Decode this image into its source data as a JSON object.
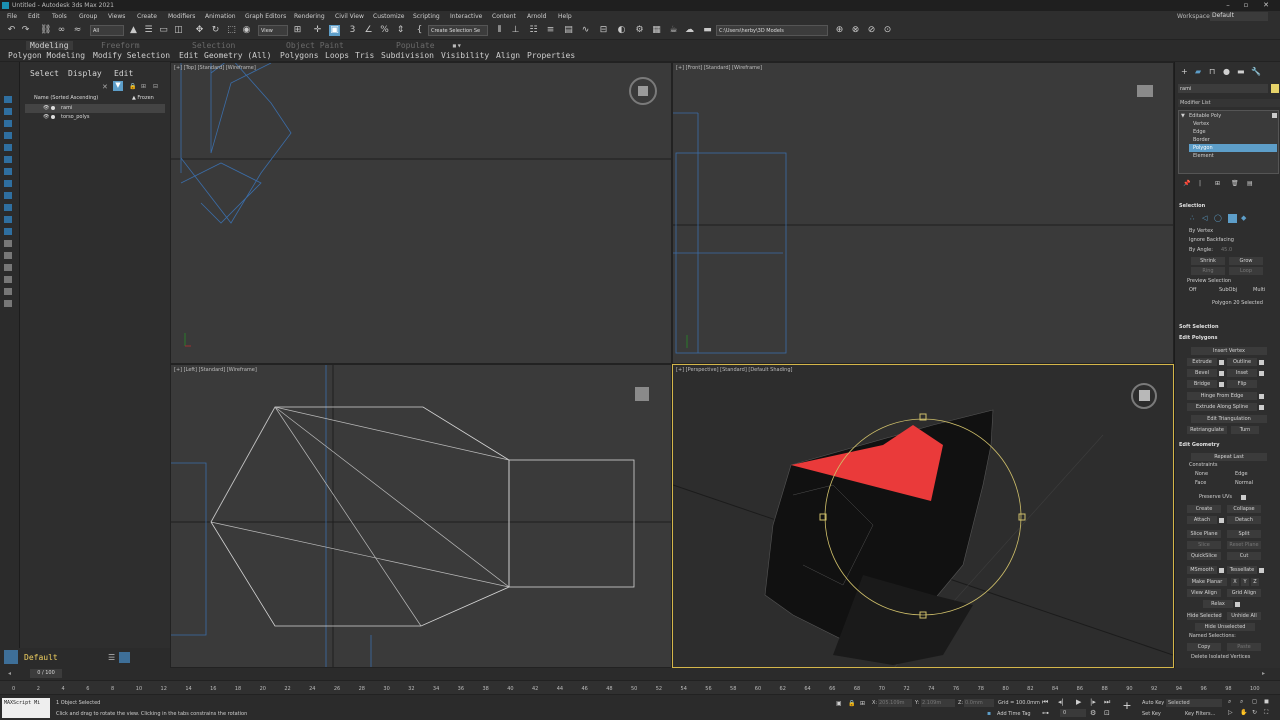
{
  "title_bar": {
    "title": "Untitled - Autodesk 3ds Max 2021"
  },
  "menu": [
    "File",
    "Edit",
    "Tools",
    "Group",
    "Views",
    "Create",
    "Modifiers",
    "Animation",
    "Graph Editors",
    "Rendering",
    "Civil View",
    "Customize",
    "Scripting",
    "Interactive",
    "Content",
    "Arnold",
    "Help"
  ],
  "workspaces": {
    "label": "Workspaces:",
    "value": "Default"
  },
  "toolbar": {
    "filter": "All",
    "ref_coord": "View",
    "named_selection": "Create Selection Se",
    "project_path": "C:\\Users\\herby\\3D Models"
  },
  "ribbon": {
    "tabs": [
      "Modeling",
      "Freeform",
      "Selection",
      "Object Paint",
      "Populate"
    ],
    "active_tab": "Modeling",
    "subtabs": [
      "Polygon Modeling",
      "Modify Selection",
      "Edit",
      "Geometry (All)",
      "Polygons",
      "Loops",
      "Tris",
      "Subdivision",
      "Visibility",
      "Align",
      "Properties"
    ]
  },
  "explorer": {
    "tabs": [
      "Select",
      "Display",
      "Edit"
    ],
    "col_name": "Name (Sorted Ascending)",
    "col_frozen": "▲ Frozen",
    "rows": [
      {
        "name": "rami",
        "selected": true
      },
      {
        "name": "torso_polys",
        "selected": false
      }
    ],
    "layer": "Default"
  },
  "viewports": {
    "top": "[+] [Top] [Standard] [Wireframe]",
    "front": "[+] [Front] [Standard] [Wireframe]",
    "left": "[+] [Left] [Standard] [Wireframe]",
    "perspective": "[+] [Perspective] [Standard] [Default Shading]"
  },
  "command_panel": {
    "object_name": "rami",
    "modifier_list": "Modifier List",
    "stack": [
      "Editable Poly",
      "Vertex",
      "Edge",
      "Border",
      "Polygon",
      "Element"
    ],
    "stack_selected": "Polygon",
    "selection": {
      "title": "Selection",
      "by_vertex": "By Vertex",
      "ignore_backfacing": "Ignore Backfacing",
      "by_angle": "By Angle:",
      "by_angle_value": "45.0",
      "shrink": "Shrink",
      "grow": "Grow",
      "ring": "Ring",
      "loop": "Loop",
      "preview": "Preview Selection",
      "preview_opts": [
        "Off",
        "SubObj",
        "Multi"
      ],
      "status": "Polygon 20 Selected"
    },
    "soft_selection": "Soft Selection",
    "edit_polygons": {
      "title": "Edit Polygons",
      "insert_vertex": "Insert Vertex",
      "extrude": "Extrude",
      "outline": "Outline",
      "bevel": "Bevel",
      "inset": "Inset",
      "bridge": "Bridge",
      "flip": "Flip",
      "hinge": "Hinge From Edge",
      "extrude_spline": "Extrude Along Spline",
      "edit_tri": "Edit Triangulation",
      "retriangulate": "Retriangulate",
      "turn": "Turn"
    },
    "edit_geometry": {
      "title": "Edit Geometry",
      "repeat_last": "Repeat Last",
      "constraints": "Constraints",
      "none": "None",
      "edge": "Edge",
      "face": "Face",
      "normal": "Normal",
      "preserve_uvs": "Preserve UVs",
      "create": "Create",
      "collapse": "Collapse",
      "attach": "Attach",
      "detach": "Detach",
      "slice_plane": "Slice Plane",
      "split": "Split",
      "slice": "Slice",
      "reset_plane": "Reset Plane",
      "quickslice": "QuickSlice",
      "cut": "Cut",
      "msmooth": "MSmooth",
      "tessellate": "Tessellate",
      "make_planar": "Make Planar",
      "x": "X",
      "y": "Y",
      "z": "Z",
      "view_align": "View Align",
      "grid_align": "Grid Align",
      "relax": "Relax",
      "hide_selected": "Hide Selected",
      "unhide_all": "Unhide All",
      "hide_unselected": "Hide Unselected",
      "named_selections": "Named Selections:",
      "copy": "Copy",
      "paste": "Paste",
      "delete_isolated": "Delete Isolated Vertices"
    }
  },
  "timeline": {
    "frame": "0 / 100",
    "ticks": [
      "0",
      "2",
      "4",
      "6",
      "8",
      "10",
      "12",
      "14",
      "16",
      "18",
      "20",
      "22",
      "24",
      "26",
      "28",
      "30",
      "32",
      "34",
      "36",
      "38",
      "40",
      "42",
      "44",
      "46",
      "48",
      "50",
      "52",
      "54",
      "56",
      "58",
      "60",
      "62",
      "64",
      "66",
      "68",
      "70",
      "72",
      "74",
      "76",
      "78",
      "80",
      "82",
      "84",
      "86",
      "88",
      "90",
      "92",
      "94",
      "96",
      "98",
      "100"
    ]
  },
  "status": {
    "maxscript": "MAXScript Mi",
    "selected": "1 Object Selected",
    "prompt": "Click and drag to rotate the view.  Clicking in the tabs constrains the rotation",
    "x_label": "X:",
    "x": "205.109m",
    "y_label": "Y:",
    "y": "2.109m",
    "z_label": "Z:",
    "z": "0.0mm",
    "grid": "Grid = 100.0mm",
    "add_time_tag": "Add Time Tag",
    "auto_key": "Auto Key",
    "set_key": "Set Key",
    "key_mode": "Selected",
    "key_filters": "Key Filters...",
    "current_frame": "0"
  }
}
